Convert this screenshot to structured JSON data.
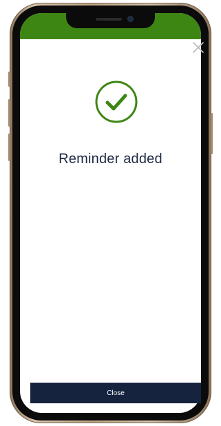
{
  "dialog": {
    "message": "Reminder added",
    "close_button_label": "Close"
  },
  "icons": {
    "success": "checkmark-circle-icon",
    "dismiss": "close-icon"
  },
  "colors": {
    "status_bar": "#3e8614",
    "success_green": "#3e8614",
    "primary_button": "#16233f",
    "message_text": "#1f2b45",
    "close_icon": "#bdbdbd"
  }
}
